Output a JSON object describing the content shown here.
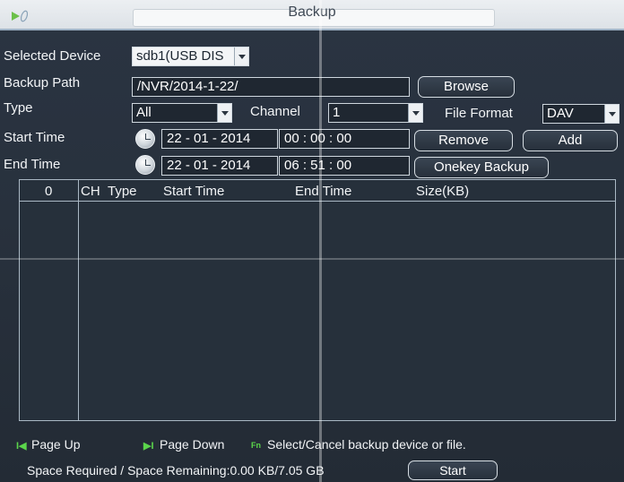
{
  "window": {
    "title": "Backup"
  },
  "device": {
    "label": "Selected Device",
    "value": "sdb1(USB DIS"
  },
  "path": {
    "label": "Backup Path",
    "value": "/NVR/2014-1-22/",
    "browse_label": "Browse"
  },
  "type": {
    "label": "Type",
    "value": "All"
  },
  "channel": {
    "label": "Channel",
    "value": "1"
  },
  "file_format": {
    "label": "File Format",
    "value": "DAV"
  },
  "start_time": {
    "label": "Start Time",
    "date": "22 - 01 - 2014",
    "time": "00 : 00 : 00",
    "remove_label": "Remove",
    "add_label": "Add"
  },
  "end_time": {
    "label": "End Time",
    "date": "22 - 01 - 2014",
    "time": "06 : 51 : 00",
    "onekey_label": "Onekey Backup"
  },
  "table": {
    "columns": [
      "0",
      "CH",
      "Type",
      "Start Time",
      "End Time",
      "Size(KB)"
    ],
    "rows": []
  },
  "footer": {
    "page_up_icon": "I◀",
    "page_up": "Page Up",
    "page_down_icon": "▶I",
    "page_down": "Page Down",
    "fn_icon": "Fn",
    "hint": "Select/Cancel backup device or file.",
    "space": "Space Required / Space Remaining:0.00 KB/7.05 GB",
    "start_label": "Start"
  },
  "colors": {
    "accent_green": "#5bd64b",
    "background": "#28313d",
    "titlebar": "#e4e8ec"
  }
}
